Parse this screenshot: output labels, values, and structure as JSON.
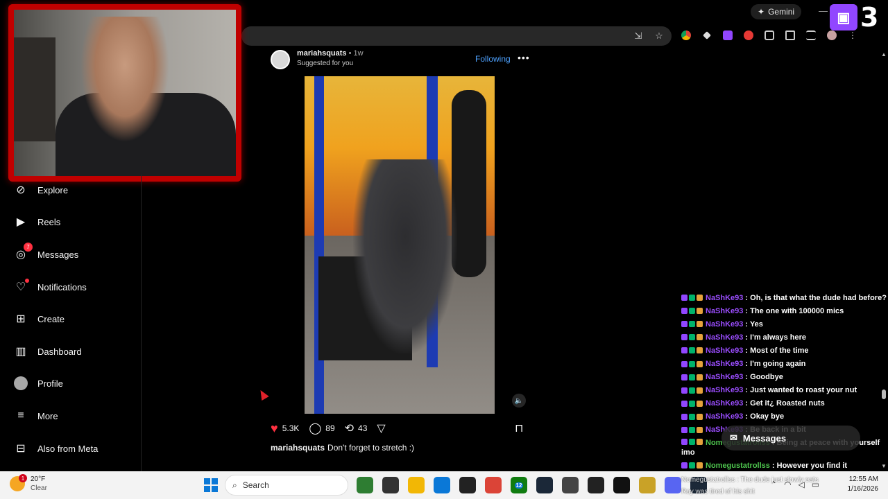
{
  "browser": {
    "gemini_label": "Gemini",
    "toolbar_icons": [
      "install-app-icon",
      "star-icon",
      "chrome-logo-icon",
      "diamond-icon",
      "twitch-ext-icon",
      "red-ext-icon",
      "puzzle-icon",
      "tab-search-icon",
      "reading-list-icon",
      "profile-icon",
      "menu-icon"
    ]
  },
  "twitch": {
    "number": "3"
  },
  "sidebar": {
    "items": [
      {
        "label": "Explore",
        "icon": "compass-icon"
      },
      {
        "label": "Reels",
        "icon": "reels-icon"
      },
      {
        "label": "Messages",
        "icon": "messenger-icon",
        "badge": "7"
      },
      {
        "label": "Notifications",
        "icon": "heart-icon"
      },
      {
        "label": "Create",
        "icon": "plus-square-icon"
      },
      {
        "label": "Dashboard",
        "icon": "dashboard-icon"
      },
      {
        "label": "Profile",
        "icon": "avatar-icon"
      },
      {
        "label": "More",
        "icon": "hamburger-icon"
      },
      {
        "label": "Also from Meta",
        "icon": "meta-apps-icon"
      }
    ]
  },
  "post": {
    "username": "mariahsquats",
    "time": "• 1w",
    "suggested": "Suggested for you",
    "follow_label": "Following",
    "likes": "5.3K",
    "comments": "89",
    "reposts": "43",
    "caption_user": "mariahsquats",
    "caption_text": "Don't forget to stretch :)"
  },
  "chat": {
    "user_colors": {
      "NaShKe93": "#9b4dff",
      "Nomegustatrollss": "#4fc84f"
    },
    "messages": [
      {
        "user": "NaShKe93",
        "text": ": Oh, is that what the dude had before?"
      },
      {
        "user": "NaShKe93",
        "text": ": The one with 100000 mics"
      },
      {
        "user": "NaShKe93",
        "text": ": Yes"
      },
      {
        "user": "NaShKe93",
        "text": ": I'm always here"
      },
      {
        "user": "NaShKe93",
        "text": ": Most of the time"
      },
      {
        "user": "NaShKe93",
        "text": ": I'm going again"
      },
      {
        "user": "NaShKe93",
        "text": ": Goodbye"
      },
      {
        "user": "NaShKe93",
        "text": ": Just wanted to roast your nut"
      },
      {
        "user": "NaShKe93",
        "text": ": Get it¿ Roasted nuts"
      },
      {
        "user": "NaShKe93",
        "text": ": Okay bye"
      },
      {
        "user": "NaShKe93",
        "text": ": Be back in a bit"
      },
      {
        "user": "Nomegustatrollss",
        "text": ": Being at peace with yourself imo"
      },
      {
        "user": "Nomegustatrollss",
        "text": ": However you find it"
      }
    ],
    "messages_pill": "Messages",
    "toast1": "Nomegustatrollss : The dude just slowly eats",
    "toast2": "Ray was tired of his shit"
  },
  "taskbar": {
    "weather_temp": "20°F",
    "weather_cond": "Clear",
    "weather_badge": "1",
    "search_placeholder": "Search",
    "apps": [
      {
        "icon": "chili-icon",
        "color": "#2e7d32"
      },
      {
        "icon": "file-icon",
        "color": "#333333"
      },
      {
        "icon": "folder-icon",
        "color": "#f2b705"
      },
      {
        "icon": "store-icon",
        "color": "#0a78d7"
      },
      {
        "icon": "obs-icon",
        "color": "#222222"
      },
      {
        "icon": "chrome-icon",
        "color": "#db4437"
      },
      {
        "icon": "xbox-icon",
        "color": "#107c10",
        "badge": "12"
      },
      {
        "icon": "steam-icon",
        "color": "#1b2838"
      },
      {
        "icon": "circle-app-icon",
        "color": "#444444"
      },
      {
        "icon": "tz-icon",
        "color": "#222222"
      },
      {
        "icon": "epic-icon",
        "color": "#111111"
      },
      {
        "icon": "r-app-icon",
        "color": "#c9a227"
      },
      {
        "icon": "discord-icon",
        "color": "#5865f2"
      },
      {
        "icon": "steam2-icon",
        "color": "#1b2838"
      }
    ],
    "time": "12:55 AM",
    "date": "1/16/2026"
  }
}
